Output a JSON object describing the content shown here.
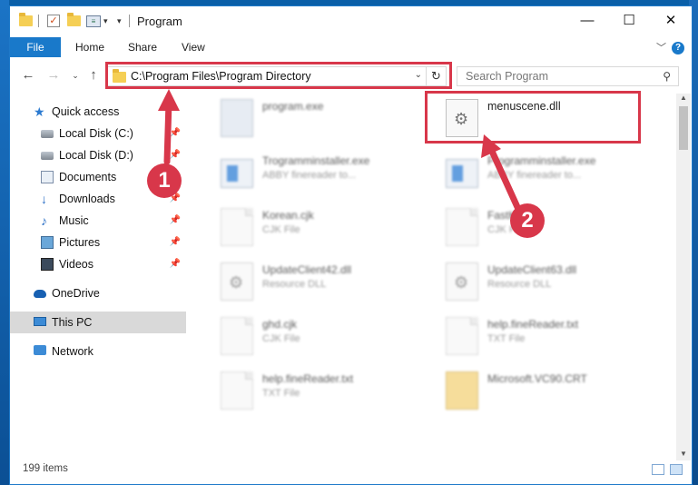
{
  "window": {
    "title": "Program",
    "controls": {
      "minimize": "—",
      "maximize": "☐",
      "close": "✕"
    }
  },
  "ribbon": {
    "tabs": [
      "File",
      "Home",
      "Share",
      "View"
    ],
    "help": "?"
  },
  "address_bar": {
    "path": "C:\\Program Files\\Program Directory",
    "refresh_icon": "refresh-icon"
  },
  "search": {
    "placeholder": "Search Program"
  },
  "sidebar": {
    "items": [
      {
        "label": "Quick access",
        "icon": "star-icon",
        "pinned": false
      },
      {
        "label": "Local Disk (C:)",
        "icon": "disk-icon",
        "pinned": true
      },
      {
        "label": "Local Disk (D:)",
        "icon": "disk-icon",
        "pinned": true
      },
      {
        "label": "Documents",
        "icon": "documents-icon",
        "pinned": true
      },
      {
        "label": "Downloads",
        "icon": "download-icon",
        "pinned": true
      },
      {
        "label": "Music",
        "icon": "music-icon",
        "pinned": true
      },
      {
        "label": "Pictures",
        "icon": "pictures-icon",
        "pinned": true
      },
      {
        "label": "Videos",
        "icon": "videos-icon",
        "pinned": true
      },
      {
        "label": "OneDrive",
        "icon": "cloud-icon",
        "pinned": false
      },
      {
        "label": "This PC",
        "icon": "pc-icon",
        "pinned": false,
        "selected": true
      },
      {
        "label": "Network",
        "icon": "network-icon",
        "pinned": false
      }
    ]
  },
  "files": [
    {
      "name": "program.exe",
      "type": "",
      "icon": "exe-icon",
      "blurred": true
    },
    {
      "name": "menuscene.dll",
      "type": "",
      "icon": "dll-icon",
      "blurred": false,
      "highlighted": true
    },
    {
      "name": "Trogramminstaller.exe",
      "type": "ABBY finereader to...",
      "icon": "app-icon",
      "blurred": true
    },
    {
      "name": "Programminstaller.exe",
      "type": "ABBY finereader to...",
      "icon": "app-icon",
      "blurred": true
    },
    {
      "name": "Korean.cjk",
      "type": "CJK File",
      "icon": "doc-icon",
      "blurred": true
    },
    {
      "name": "FastK",
      "type": "CJK File",
      "icon": "doc-icon",
      "blurred": true
    },
    {
      "name": "UpdateClient42.dll",
      "type": "Resource DLL",
      "icon": "dll-icon",
      "blurred": true
    },
    {
      "name": "UpdateClient63.dll",
      "type": "Resource DLL",
      "icon": "dll-icon",
      "blurred": true
    },
    {
      "name": "ghd.cjk",
      "type": "CJK File",
      "icon": "doc-icon",
      "blurred": true
    },
    {
      "name": "help.fineReader.txt",
      "type": "TXT File",
      "icon": "doc-icon",
      "blurred": true
    },
    {
      "name": "help.fineReader.txt",
      "type": "TXT File",
      "icon": "doc-icon",
      "blurred": true
    },
    {
      "name": "Microsoft.VC90.CRT",
      "type": "",
      "icon": "folder-icon",
      "blurred": true
    }
  ],
  "annotations": {
    "marker1": "1",
    "marker2": "2",
    "color": "#d8374a"
  },
  "status": {
    "item_count": "199 items"
  },
  "colors": {
    "accent": "#1979ca",
    "selection": "#d9d9d9",
    "annotation": "#d8374a"
  }
}
